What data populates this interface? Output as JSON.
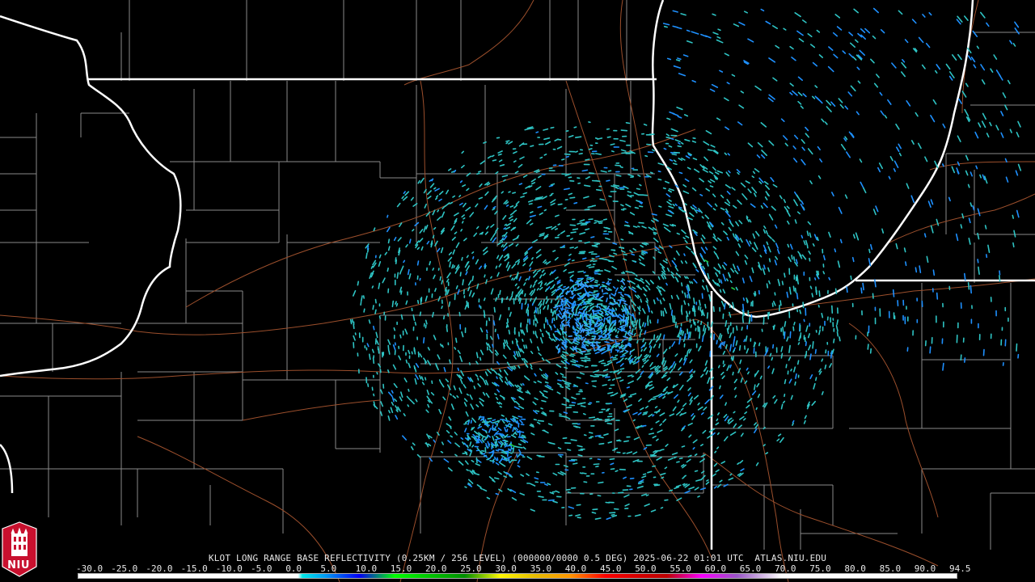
{
  "caption": {
    "site": "KLOT",
    "product": "LONG RANGE BASE REFLECTIVITY",
    "resolution": "(0.25KM / 256 LEVEL)",
    "volume": "(000000/0000",
    "tilt": "0.5 DEG)",
    "datetime": "2025-06-22 01:01 UTC",
    "source": "ATLAS.NIU.EDU"
  },
  "logo": {
    "text": "NIU",
    "icon": "niu-tower-logo-icon"
  },
  "scale": {
    "labels": [
      "-30.0",
      "-25.0",
      "-20.0",
      "-15.0",
      "-10.0",
      "-5.0",
      "0.0",
      "5.0",
      "10.0",
      "15.0",
      "20.0",
      "25.0",
      "30.0",
      "35.0",
      "40.0",
      "45.0",
      "50.0",
      "55.0",
      "60.0",
      "65.0",
      "70.0",
      "75.0",
      "80.0",
      "85.0",
      "90.0",
      "94.5"
    ],
    "colors": [
      "#000000",
      "#000000",
      "#000000",
      "#000000",
      "#000000",
      "#000000",
      "#00e8e8",
      "#019ff4",
      "#0300f4",
      "#02fd02",
      "#01c501",
      "#008e00",
      "#fdf802",
      "#e5bc00",
      "#fd9500",
      "#fd0000",
      "#d40000",
      "#bc0000",
      "#f800fd",
      "#9854c6",
      "#fdfdfd",
      "#fdfdfd"
    ]
  },
  "colors": {
    "background": "#000000",
    "state_lines": "#ffffff",
    "county_lines": "#8c8c8c",
    "highways": "#a0522d",
    "echo_cyan": "#2ec4c4",
    "echo_blue": "#1e90ff",
    "echo_green": "#22cc44"
  }
}
